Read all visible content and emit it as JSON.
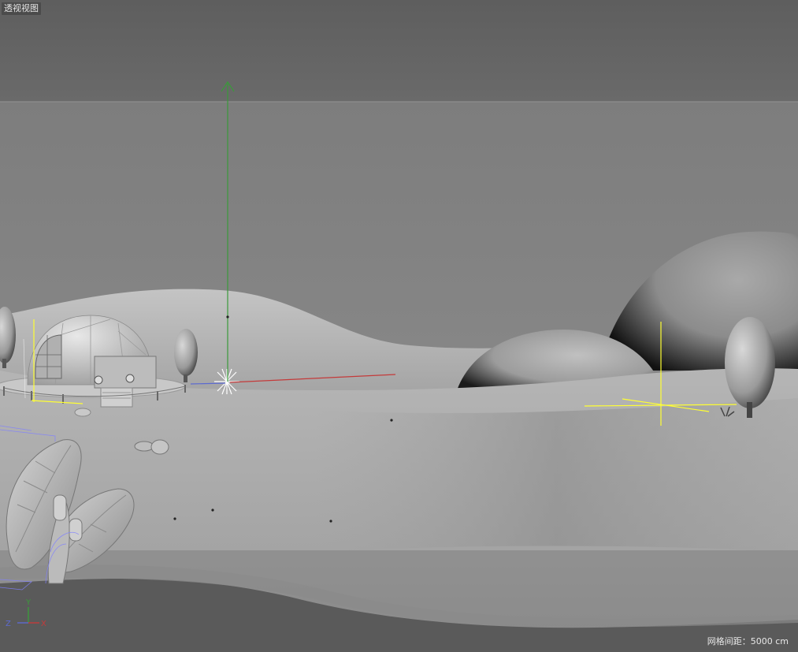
{
  "viewport": {
    "view_name": "透视视图",
    "grid_spacing_label": "网格间距：5000 cm"
  },
  "axis_gizmo": {
    "y_label": "Y",
    "x_label": "X",
    "z_label": "Z"
  },
  "colors": {
    "y_axis": "#3a9a3a",
    "x_axis": "#c43a3a",
    "z_axis": "#5c6ad0",
    "light_gizmo": "#ffff33",
    "selection": "#8080ff"
  },
  "scene_objects": [
    "dome-house",
    "trees",
    "hills",
    "rocks",
    "leaves",
    "lights",
    "sky"
  ]
}
